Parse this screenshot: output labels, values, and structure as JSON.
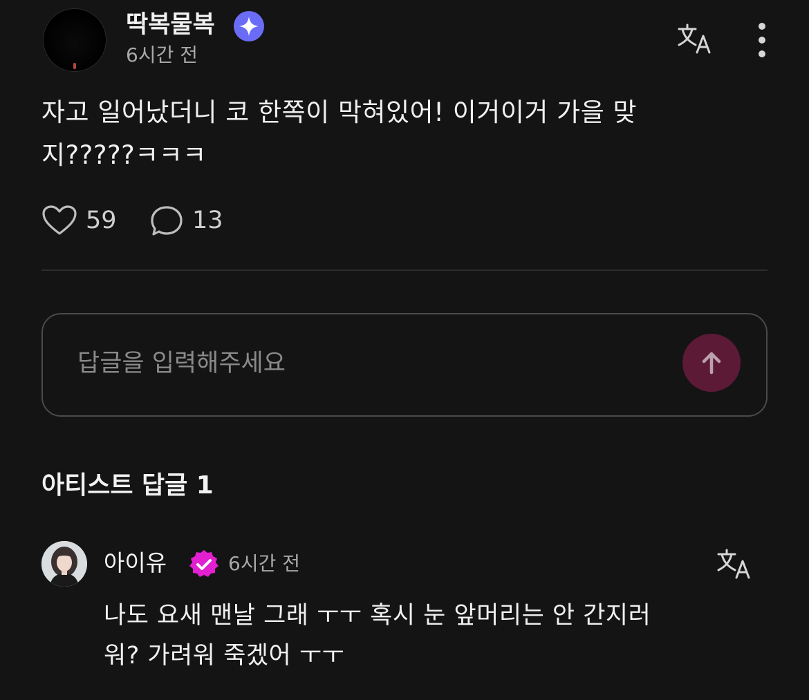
{
  "post": {
    "author": "딱복물복",
    "time": "6시간 전",
    "text_line1": "자고 일어났더니 코 한쪽이 막혀있어! 이거이거 가을 맞",
    "text_line2": "지?????ㅋㅋㅋ",
    "likes": "59",
    "comments": "13",
    "badge_icon": "sparkle-badge-icon",
    "badge_color": "#6b6cf6"
  },
  "reply_box": {
    "placeholder": "답글을 입력해주세요",
    "send_button_color": "#5c1a37"
  },
  "artist_replies": {
    "title": "아티스트 답글 1",
    "items": [
      {
        "author": "아이유",
        "time": "6시간 전",
        "text_line1": "나도 요새 맨날 그래 ㅜㅜ 혹시 눈 앞머리는 안 간지러",
        "text_line2": "워? 가려워 죽겠어 ㅜㅜ",
        "badge_icon": "verified-check-badge-icon",
        "badge_color": "#e21fd1"
      }
    ]
  },
  "colors": {
    "background": "#141414",
    "text_primary": "#f0f0f0",
    "text_secondary": "#a9a9a9",
    "divider": "#2c2c2c"
  }
}
